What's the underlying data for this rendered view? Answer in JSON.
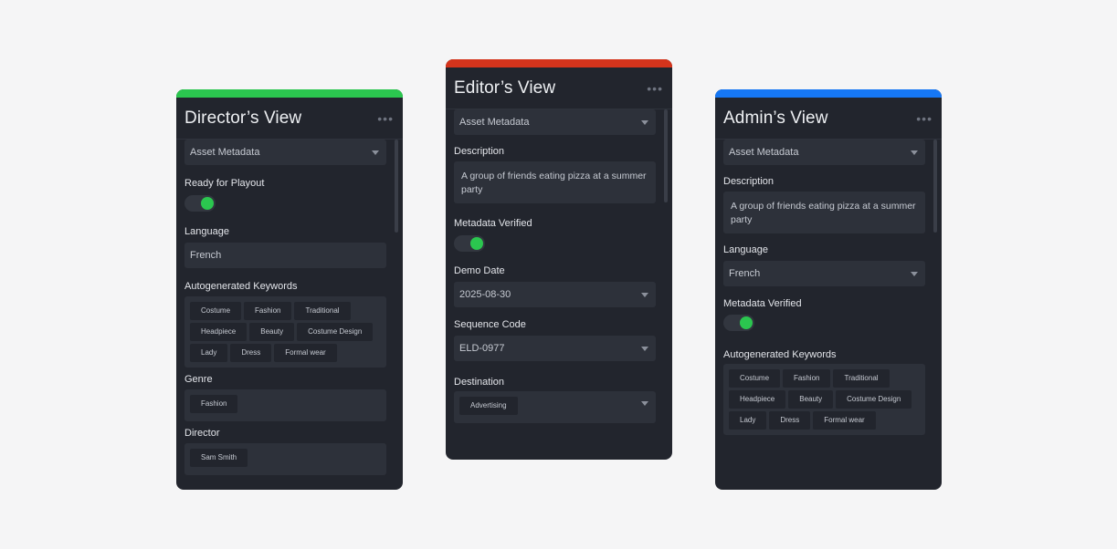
{
  "colors": {
    "director_accent": "#2bc64f",
    "editor_accent": "#d5341c",
    "admin_accent": "#1677f4",
    "toggle_on": "#2bc64f"
  },
  "director": {
    "title": "Director’s View",
    "more_icon": "•••",
    "section_select": "Asset Metadata",
    "ready_label": "Ready for Playout",
    "ready_value": true,
    "language_label": "Language",
    "language_value": "French",
    "keywords_label": "Autogenerated Keywords",
    "keywords": [
      "Costume",
      "Fashion",
      "Traditional",
      "Headpiece",
      "Beauty",
      "Costume Design",
      "Lady",
      "Dress",
      "Formal wear"
    ],
    "genre_label": "Genre",
    "genre_tags": [
      "Fashion"
    ],
    "director_label": "Director",
    "director_tags": [
      "Sam Smith"
    ]
  },
  "editor": {
    "title": "Editor’s View",
    "more_icon": "•••",
    "section_select": "Asset Metadata",
    "description_label": "Description",
    "description_value": "A group of friends eating pizza at a summer party",
    "verified_label": "Metadata Verified",
    "verified_value": true,
    "demo_date_label": "Demo Date",
    "demo_date_value": "2025-08-30",
    "sequence_label": "Sequence Code",
    "sequence_value": "ELD-0977",
    "destination_label": "Destination",
    "destination_tags": [
      "Advertising"
    ]
  },
  "admin": {
    "title": "Admin’s View",
    "more_icon": "•••",
    "section_select": "Asset Metadata",
    "description_label": "Description",
    "description_value": "A group of friends eating pizza at a summer party",
    "language_label": "Language",
    "language_value": "French",
    "verified_label": "Metadata Verified",
    "verified_value": true,
    "keywords_label": "Autogenerated Keywords",
    "keywords": [
      "Costume",
      "Fashion",
      "Traditional",
      "Headpiece",
      "Beauty",
      "Costume Design",
      "Lady",
      "Dress",
      "Formal wear"
    ]
  }
}
